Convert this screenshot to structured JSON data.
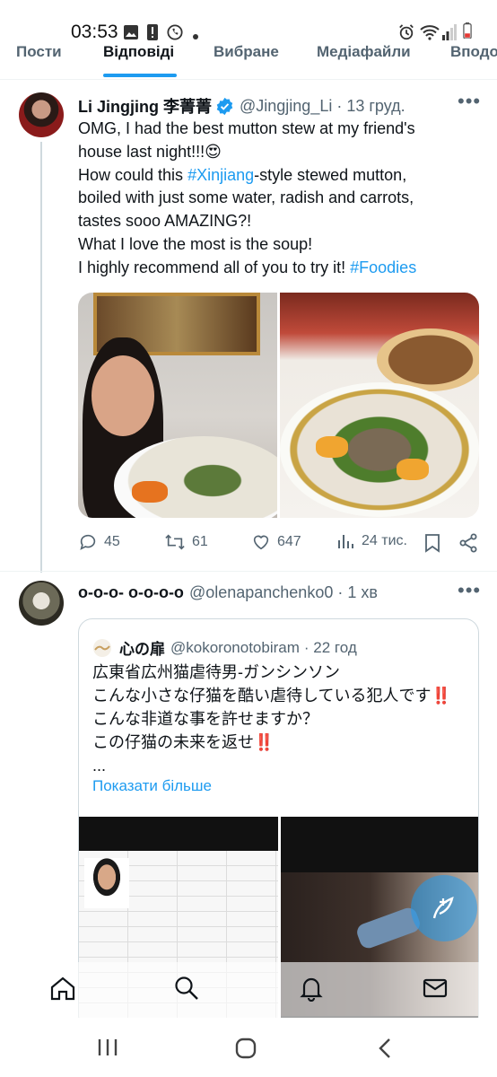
{
  "status_bar": {
    "time": "03:53",
    "icons_left": [
      "image-icon",
      "alert-icon",
      "viber-icon",
      "dot-icon"
    ],
    "icons_right": [
      "alarm-icon",
      "wifi-icon",
      "signal-icon",
      "battery-icon"
    ]
  },
  "tabs": [
    {
      "label": "Пости",
      "active": false
    },
    {
      "label": "Відповіді",
      "active": true
    },
    {
      "label": "Вибране",
      "active": false
    },
    {
      "label": "Медіафайли",
      "active": false
    },
    {
      "label": "Вподо",
      "active": false
    }
  ],
  "tweet1": {
    "name": "Li Jingjing 李菁菁",
    "verified": true,
    "handle": "@Jingjing_Li",
    "date": "· 13 груд.",
    "lines": [
      {
        "text": "OMG, I had the best mutton stew at my friend's"
      },
      {
        "text": "house last night!!!😍"
      },
      {
        "pre": "How could this ",
        "link": "#Xinjiang",
        "post": "-style stewed mutton,"
      },
      {
        "text": "boiled with just some water, radish and carrots,"
      },
      {
        "text": "tastes sooo AMAZING?!"
      },
      {
        "text": "What I love the most is the soup!"
      },
      {
        "pre": "I highly recommend all of you to try it! ",
        "link": "#Foodies",
        "post": ""
      }
    ],
    "stats": {
      "replies": "45",
      "retweets": "61",
      "likes": "647",
      "views": "24 тис."
    }
  },
  "tweet2": {
    "name": "o-o-o- o-o-o-o",
    "handle": "@olenapanchenko0",
    "date": "· 1 хв",
    "quote": {
      "name": "心の扉",
      "handle": "@kokoronotobiram",
      "date": "· 22 год",
      "lines": [
        "広東省広州猫虐待男-ガンシンソン",
        "こんな小さな仔猫を酷い虐待している犯人です‼️",
        "こんな非道な事を許せますか？",
        "この仔猫の未来を返せ‼️",
        "..."
      ],
      "show_more": "Показати більше"
    }
  },
  "colors": {
    "accent": "#1d9bf0",
    "text": "#0f1419",
    "secondary": "#536471"
  }
}
